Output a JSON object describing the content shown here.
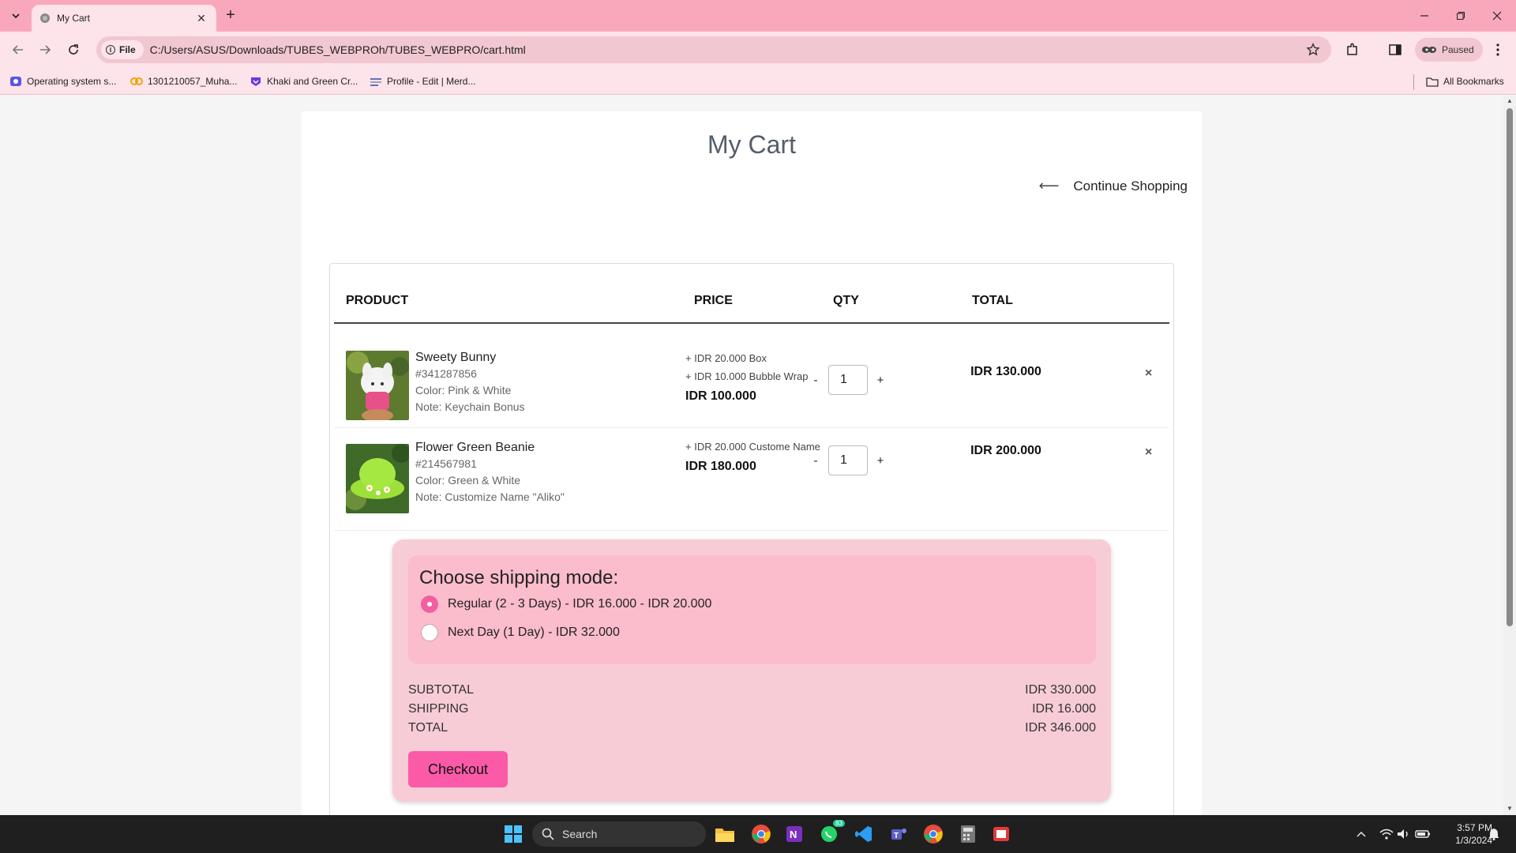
{
  "browser": {
    "tab_title": "My Cart",
    "url_chip": "File",
    "url": "C:/Users/ASUS/Downloads/TUBES_WEBPROh/TUBES_WEBPRO/cart.html",
    "profile_status": "Paused",
    "bookmarks": [
      "Operating system s...",
      "1301210057_Muha...",
      "Khaki and Green Cr...",
      "Profile - Edit | Merd..."
    ],
    "all_bookmarks": "All Bookmarks"
  },
  "page": {
    "title": "My Cart",
    "continue_arrow": "⟵",
    "continue_label": "Continue Shopping",
    "headers": {
      "product": "PRODUCT",
      "price": "PRICE",
      "qty": "QTY",
      "total": "TOTAL"
    },
    "items": [
      {
        "name": "Sweety Bunny",
        "sku": "#341287856",
        "color": "Color: Pink & White",
        "note": "Note: Keychain Bonus",
        "addons": [
          "+ IDR 20.000 Box",
          "+ IDR 10.000 Bubble Wrap"
        ],
        "price": "IDR 100.000",
        "qty": "1",
        "total": "IDR 130.000"
      },
      {
        "name": "Flower Green Beanie",
        "sku": "#214567981",
        "color": "Color: Green & White",
        "note": "Note: Customize Name \"Aliko\"",
        "addons": [
          "+ IDR 20.000 Custome Name"
        ],
        "price": "IDR 180.000",
        "qty": "1",
        "total": "IDR 200.000"
      }
    ],
    "qty_minus": "-",
    "qty_plus": "+",
    "remove_symbol": "×",
    "shipping": {
      "title": "Choose shipping mode:",
      "options": [
        {
          "label": "Regular (2 - 3 Days) - IDR 16.000 - IDR 20.000",
          "selected": true
        },
        {
          "label": "Next Day (1 Day) - IDR 32.000",
          "selected": false
        }
      ]
    },
    "summary": {
      "subtotal_label": "SUBTOTAL",
      "subtotal": "IDR 330.000",
      "shipping_label": "SHIPPING",
      "shipping": "IDR 16.000",
      "total_label": "TOTAL",
      "total": "IDR 346.000"
    },
    "checkout_label": "Checkout"
  },
  "taskbar": {
    "search_placeholder": "Search",
    "whatsapp_badge": "83",
    "time": "3:57 PM",
    "date": "1/3/2024"
  },
  "colors": {
    "chrome_pink": "#f9a8bc",
    "accent_pink": "#fb5aa8",
    "ship_card": "#f7ccd7"
  }
}
